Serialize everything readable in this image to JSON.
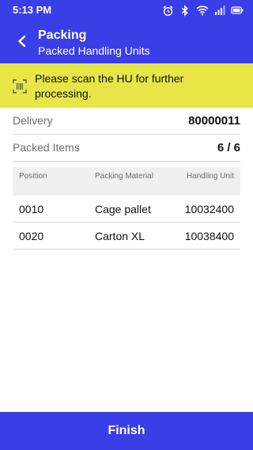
{
  "status_bar": {
    "time": "5:13 PM",
    "icons": [
      "alarm-icon",
      "bluetooth-icon",
      "wifi-icon",
      "signal-icon",
      "battery-icon"
    ]
  },
  "header": {
    "title": "Packing",
    "subtitle": "Packed Handling Units",
    "back_icon": "back-arrow-icon"
  },
  "banner": {
    "icon": "barcode-scan-icon",
    "text": "Please scan the HU for further processing."
  },
  "summary": [
    {
      "label": "Delivery",
      "value": "80000011"
    },
    {
      "label": "Packed Items",
      "value": "6 / 6"
    }
  ],
  "table": {
    "columns": [
      "Position",
      "Packing Material",
      "Handling Unit"
    ],
    "rows": [
      {
        "position": "0010",
        "material": "Cage pallet",
        "hu": "10032400"
      },
      {
        "position": "0020",
        "material": "Carton XL",
        "hu": "10038400"
      }
    ]
  },
  "footer": {
    "finish_label": "Finish"
  },
  "colors": {
    "primary": "#3a3ee6",
    "banner": "#e7e646"
  }
}
